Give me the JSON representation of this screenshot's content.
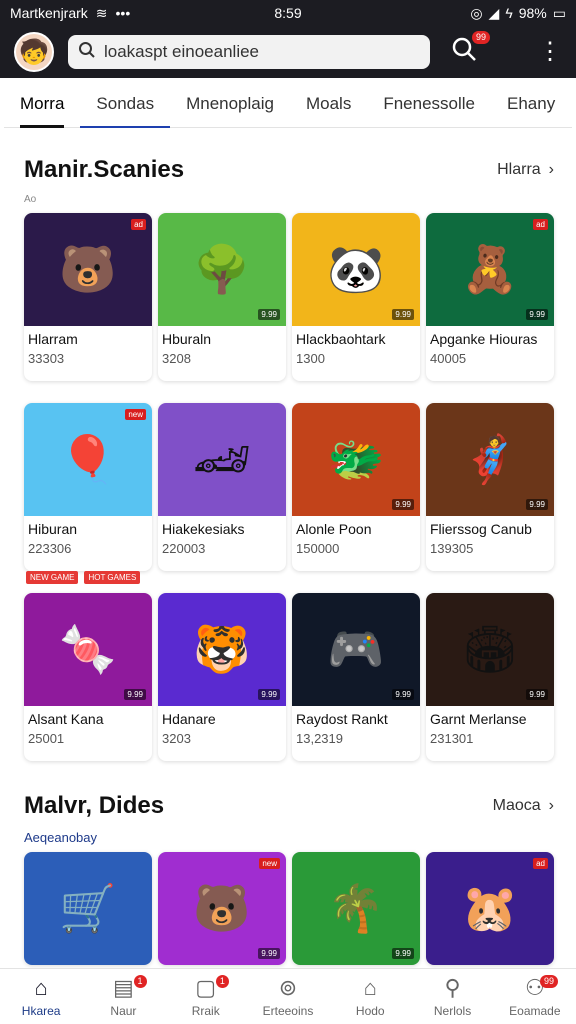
{
  "status": {
    "carrier": "Martkenjrark",
    "time": "8:59",
    "battery": "98%"
  },
  "search": {
    "value": "loakaspt einoeanliee"
  },
  "header": {
    "notification_badge": "99"
  },
  "tabs": [
    {
      "label": "Morra"
    },
    {
      "label": "Sondas"
    },
    {
      "label": "Mnenoplaig"
    },
    {
      "label": "Moals"
    },
    {
      "label": "Fnenessolle"
    },
    {
      "label": "Ehany"
    }
  ],
  "section1": {
    "title": "Manir.Scanies",
    "more": "Hlarra",
    "subtitle": "Ao"
  },
  "grid1": [
    {
      "name": "Hlarram",
      "count": "33303",
      "icon": "bear-icon",
      "bg": "#2b1a4a",
      "tag": "ad"
    },
    {
      "name": "Hburaln",
      "count": "3208",
      "icon": "garden-icon",
      "bg": "#58b947",
      "corner": "9.99"
    },
    {
      "name": "Hlackbaohtark",
      "count": "1300",
      "icon": "panda-icon",
      "bg": "#f2b51a",
      "corner": "9.99"
    },
    {
      "name": "Apganke Hiouras",
      "count": "40005",
      "icon": "purple-bear-icon",
      "bg": "#0e6b3e",
      "tag": "ad",
      "corner": "9.99"
    },
    {
      "name": "Hiburan",
      "count": "223306",
      "icon": "balloon-icon",
      "bg": "#58c3f2",
      "tag": "new"
    },
    {
      "name": "Hiakekesiaks",
      "count": "220003",
      "icon": "racing-icon",
      "bg": "#8050c8"
    },
    {
      "name": "Alonle Poon",
      "count": "150000",
      "icon": "dragon-icon",
      "bg": "#c2431a",
      "corner": "9.99"
    },
    {
      "name": "Flierssog Canub",
      "count": "139305",
      "icon": "hero-icon",
      "bg": "#6b3619",
      "corner": "9.99"
    },
    {
      "name": "Alsant Kana",
      "count": "25001",
      "icon": "candy-icon",
      "bg": "#8f1a9c",
      "corner": "9.99"
    },
    {
      "name": "Hdanare",
      "count": "3203",
      "icon": "bear-hero-icon",
      "bg": "#5a2ad0",
      "corner": "9.99"
    },
    {
      "name": "Raydost Rankt",
      "count": "13,2319",
      "icon": "poster-icon",
      "bg": "#101828",
      "corner": "9.99"
    },
    {
      "name": "Garnt Merlanse",
      "count": "231301",
      "icon": "arena-icon",
      "bg": "#2a1a14",
      "corner": "9.99"
    }
  ],
  "pills": [
    "NEW GAME",
    "HOT GAMES"
  ],
  "section2": {
    "title": "Malvr, Dides",
    "more": "Maoca",
    "subtitle": "Aeqeanobay"
  },
  "grid2": [
    {
      "icon": "cart-icon",
      "bg": "#2c5eb8"
    },
    {
      "icon": "fantasy-bear-icon",
      "bg": "#a02dd0",
      "tag": "new",
      "corner": "9.99"
    },
    {
      "icon": "jungle-icon",
      "bg": "#2a9a38",
      "corner": "9.99"
    },
    {
      "icon": "red-bear-icon",
      "bg": "#3a1e8c",
      "tag": "ad"
    }
  ],
  "bottom_nav": [
    {
      "label": "Hkarea",
      "icon": "home-icon",
      "glyph": "⌂",
      "active": true
    },
    {
      "label": "Naur",
      "icon": "news-icon",
      "glyph": "▤",
      "badge": "1"
    },
    {
      "label": "Rraik",
      "icon": "square-icon",
      "glyph": "▢",
      "badge": "1"
    },
    {
      "label": "Erteeoins",
      "icon": "compass-icon",
      "glyph": "⊚"
    },
    {
      "label": "Hodo",
      "icon": "house-icon",
      "glyph": "⌂"
    },
    {
      "label": "Nerlols",
      "icon": "search-icon",
      "glyph": "⚲"
    },
    {
      "label": "Eoamade",
      "icon": "profile-icon",
      "glyph": "⚇",
      "badge": "99"
    }
  ]
}
